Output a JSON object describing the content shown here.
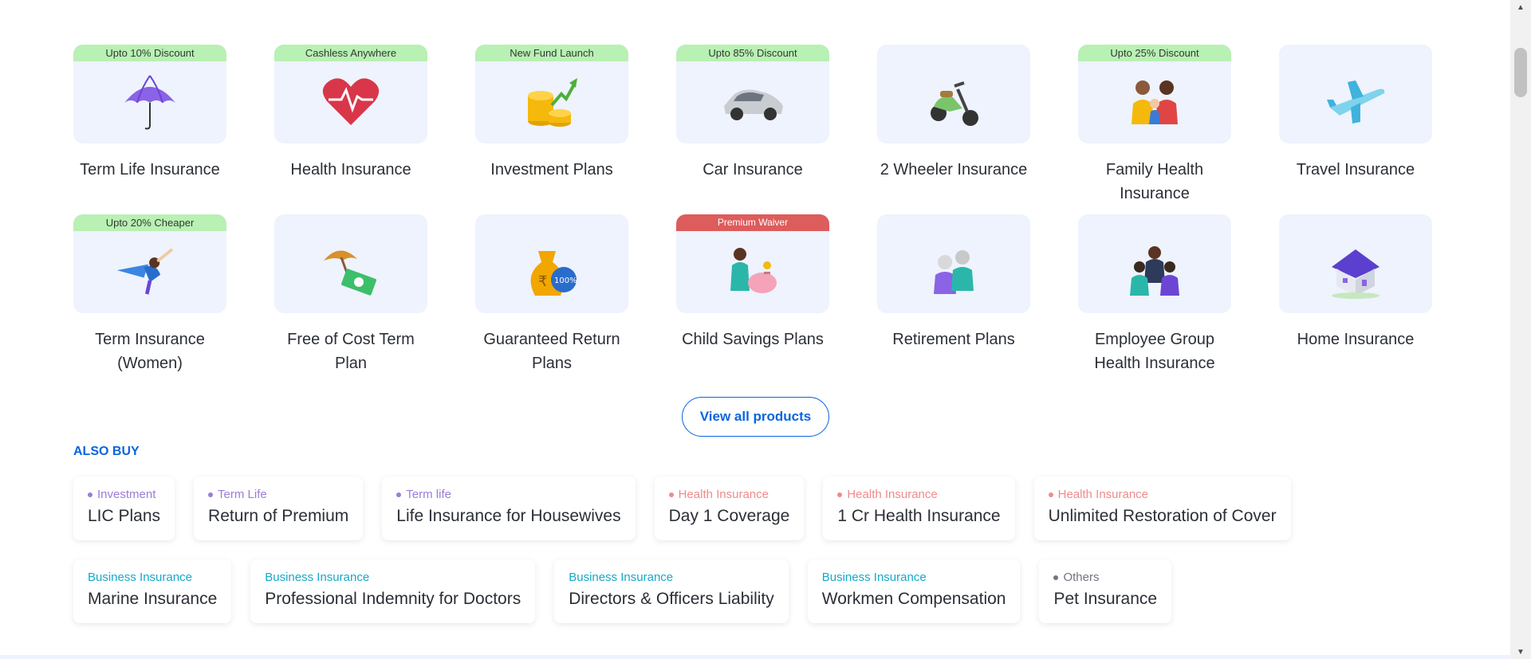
{
  "products": {
    "row1": [
      {
        "label": "Term Life Insurance",
        "badge": "Upto 10% Discount",
        "badge_style": "green",
        "icon": "umbrella-icon"
      },
      {
        "label": "Health Insurance",
        "badge": "Cashless Anywhere",
        "badge_style": "green",
        "icon": "heart-pulse-icon"
      },
      {
        "label": "Investment Plans",
        "badge": "New Fund Launch",
        "badge_style": "green",
        "icon": "coins-growth-icon"
      },
      {
        "label": "Car Insurance",
        "badge": "Upto 85% Discount",
        "badge_style": "green",
        "icon": "car-icon"
      },
      {
        "label": "2 Wheeler Insurance",
        "badge": "",
        "badge_style": "none",
        "icon": "scooter-icon"
      },
      {
        "label": "Family Health Insurance",
        "badge": "Upto 25% Discount",
        "badge_style": "green",
        "icon": "family-icon"
      },
      {
        "label": "Travel Insurance",
        "badge": "",
        "badge_style": "none",
        "icon": "airplane-icon"
      }
    ],
    "row2": [
      {
        "label": "Term Insurance (Women)",
        "badge": "Upto 20% Cheaper",
        "badge_style": "green",
        "icon": "superwoman-icon"
      },
      {
        "label": "Free of Cost Term Plan",
        "badge": "",
        "badge_style": "none",
        "icon": "umbrella-cash-icon"
      },
      {
        "label": "Guaranteed Return Plans",
        "badge": "",
        "badge_style": "none",
        "icon": "money-bag-icon"
      },
      {
        "label": "Child Savings Plans",
        "badge": "Premium Waiver",
        "badge_style": "red",
        "icon": "child-piggybank-icon"
      },
      {
        "label": "Retirement Plans",
        "badge": "",
        "badge_style": "none",
        "icon": "elderly-couple-icon"
      },
      {
        "label": "Employee Group Health Insurance",
        "badge": "",
        "badge_style": "none",
        "icon": "employee-group-icon"
      },
      {
        "label": "Home Insurance",
        "badge": "",
        "badge_style": "none",
        "icon": "house-icon"
      }
    ]
  },
  "view_all_label": "View all products",
  "also_buy": {
    "title": "ALSO BUY",
    "row1": [
      {
        "category": "Investment",
        "title": "LIC Plans",
        "cat_class": "investment",
        "dot": true
      },
      {
        "category": "Term Life",
        "title": "Return of Premium",
        "cat_class": "term",
        "dot": true
      },
      {
        "category": "Term life",
        "title": "Life Insurance for Housewives",
        "cat_class": "term",
        "dot": true
      },
      {
        "category": "Health Insurance",
        "title": "Day 1 Coverage",
        "cat_class": "health",
        "dot": true
      },
      {
        "category": "Health Insurance",
        "title": "1 Cr Health Insurance",
        "cat_class": "health",
        "dot": true
      },
      {
        "category": "Health Insurance",
        "title": "Unlimited Restoration of Cover",
        "cat_class": "health",
        "dot": true
      }
    ],
    "row2": [
      {
        "category": "Business Insurance",
        "title": "Marine Insurance",
        "cat_class": "business",
        "dot": false
      },
      {
        "category": "Business Insurance",
        "title": "Professional Indemnity for Doctors",
        "cat_class": "business",
        "dot": false
      },
      {
        "category": "Business Insurance",
        "title": "Directors & Officers Liability",
        "cat_class": "business",
        "dot": false
      },
      {
        "category": "Business Insurance",
        "title": "Workmen Compensation",
        "cat_class": "business",
        "dot": false
      },
      {
        "category": "Others",
        "title": "Pet Insurance",
        "cat_class": "others",
        "dot": true
      }
    ]
  },
  "colors": {
    "accent": "#0a65e0",
    "card_bg": "#eef3fd",
    "badge_green": "#b9f0b4",
    "badge_red": "#dd5c5c"
  }
}
